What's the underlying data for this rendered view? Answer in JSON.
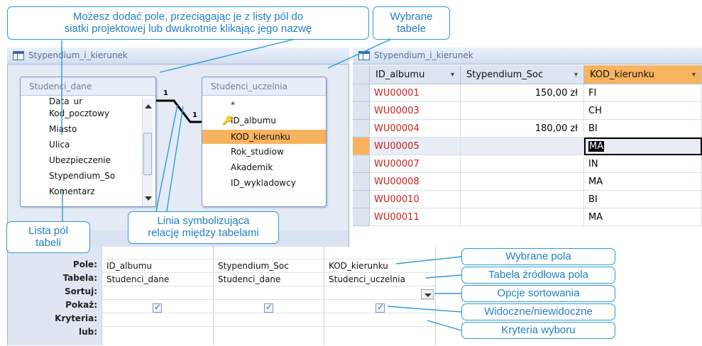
{
  "query_window": {
    "title": "Stypendium_i_kierunek"
  },
  "tables": {
    "left": {
      "name": "Studenci_dane",
      "fields": [
        "Data_ur",
        "Kod_pocztowy",
        "Miasto",
        "Ulica",
        "Ubezpieczenie",
        "Stypendium_So",
        "Komentarz"
      ]
    },
    "right": {
      "name": "Studenci_uczelnia",
      "fields": [
        "*",
        "ID_albumu",
        "KOD_kierunku",
        "Rok_studiow",
        "Akademik",
        "ID_wykladowcy"
      ],
      "selected": "KOD_kierunku",
      "key_field": "ID_albumu"
    },
    "relation": {
      "left_cardinality": "1",
      "right_cardinality": "1"
    }
  },
  "grid": {
    "row_labels": [
      "Pole:",
      "Tabela:",
      "Sortuj:",
      "Pokaż:",
      "Kryteria:",
      "lub:"
    ],
    "columns": [
      {
        "field": "ID_albumu",
        "table": "Studenci_dane",
        "show": true
      },
      {
        "field": "Stypendium_Soc",
        "table": "Studenci_dane",
        "show": true
      },
      {
        "field": "KOD_kierunku",
        "table": "Studenci_uczelnia",
        "show": true
      }
    ]
  },
  "datasheet": {
    "title": "Stypendium_i_kierunek",
    "headers": [
      "ID_albumu",
      "Stypendium_Soc",
      "KOD_kierunku"
    ],
    "rows": [
      {
        "id": "WU00001",
        "stypendium": "150,00 zł",
        "kod": "FI"
      },
      {
        "id": "WU00003",
        "stypendium": "",
        "kod": "CH"
      },
      {
        "id": "WU00004",
        "stypendium": "180,00 zł",
        "kod": "BI"
      },
      {
        "id": "WU00005",
        "stypendium": "",
        "kod": "MA"
      },
      {
        "id": "WU00007",
        "stypendium": "",
        "kod": "IN"
      },
      {
        "id": "WU00008",
        "stypendium": "",
        "kod": "MA"
      },
      {
        "id": "WU00010",
        "stypendium": "",
        "kod": "BI"
      },
      {
        "id": "WU00011",
        "stypendium": "",
        "kod": "MA"
      }
    ],
    "selected_row": 3
  },
  "callouts": {
    "add_field_line1": "Możesz dodać pole, przeciągając je z listy pól do",
    "add_field_line2": "siatki projektowej lub dwukrotnie klikając jego nazwę",
    "selected_tables_line1": "Wybrane",
    "selected_tables_line2": "tabele",
    "relation_line1": "Linia symbolizująca",
    "relation_line2": "relację między tabelami",
    "field_list_line1": "Lista pól",
    "field_list_line2": "tabeli",
    "selected_fields": "Wybrane pola",
    "source_table": "Tabela źródłowa pola",
    "sort_options": "Opcje sortowania",
    "visible": "Widoczne/niewidoczne",
    "criteria": "Kryteria wyboru"
  },
  "colors": {
    "accent": "#2a9ad6",
    "selection": "#f8b35f",
    "id_red": "#cc1f1f"
  }
}
